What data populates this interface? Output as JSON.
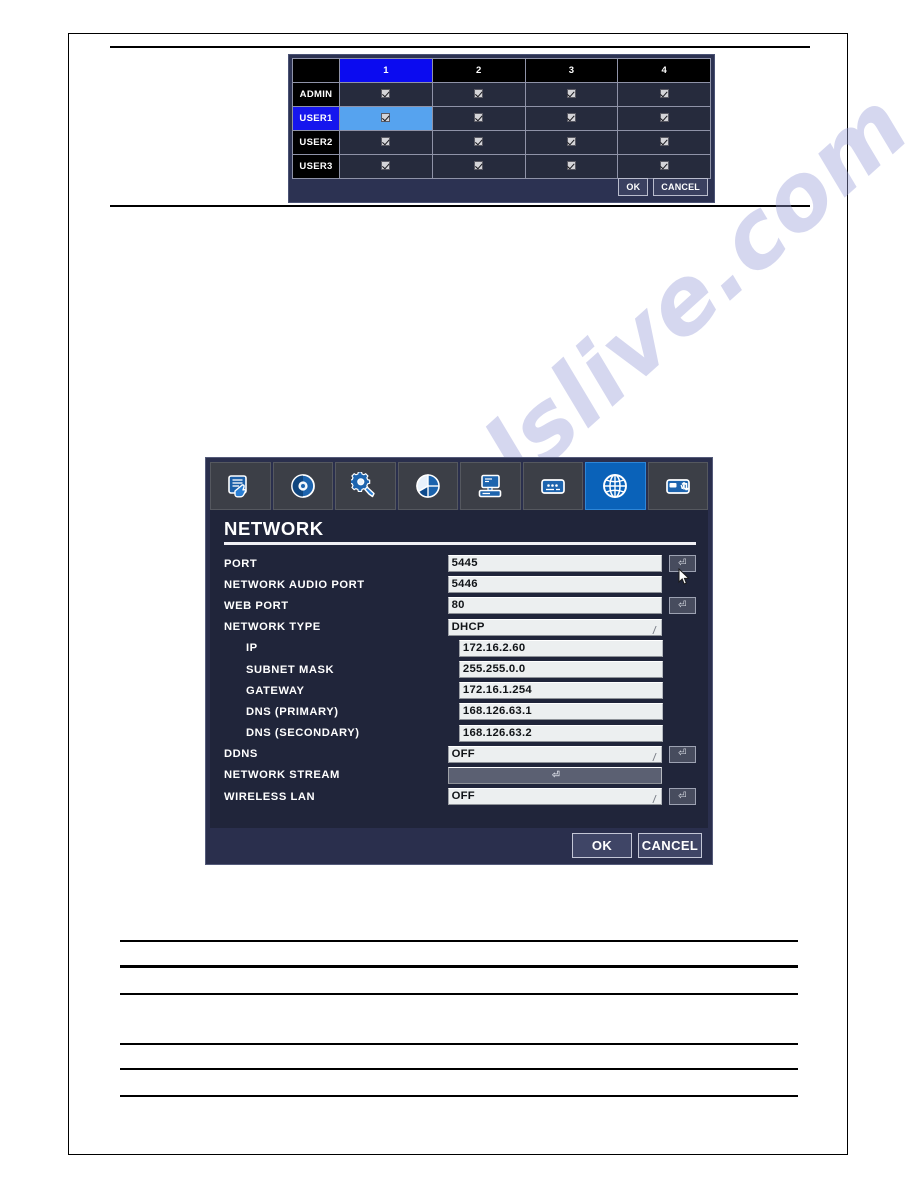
{
  "watermark": {
    "text": "manualslive.com"
  },
  "permission_dialog": {
    "name": "user-channel-permission",
    "columns": [
      "",
      "1",
      "2",
      "3",
      "4"
    ],
    "selected_column": "1",
    "selected_row": "USER1",
    "rows": [
      {
        "label": "ADMIN",
        "checks": [
          true,
          true,
          true,
          true
        ]
      },
      {
        "label": "USER1",
        "checks": [
          true,
          true,
          true,
          true
        ]
      },
      {
        "label": "USER2",
        "checks": [
          true,
          true,
          true,
          true
        ]
      },
      {
        "label": "USER3",
        "checks": [
          true,
          true,
          true,
          true
        ]
      }
    ],
    "buttons": {
      "ok": "OK",
      "cancel": "CANCEL"
    },
    "colors": {
      "header_selected": "#0b0bf0",
      "row_selected": "#1616ee",
      "cell_selected": "#56a3ef"
    }
  },
  "network_dialog": {
    "title": "NETWORK",
    "tabs": [
      {
        "name": "system-icon",
        "label": "SYSTEM",
        "active": false
      },
      {
        "name": "record-icon",
        "label": "RECORD",
        "active": false
      },
      {
        "name": "device-icon",
        "label": "DEVICE",
        "active": false
      },
      {
        "name": "display-icon",
        "label": "DISPLAY",
        "active": false
      },
      {
        "name": "storage-icon",
        "label": "STORAGE",
        "active": false
      },
      {
        "name": "event-icon",
        "label": "EVENT",
        "active": false
      },
      {
        "name": "network-icon",
        "label": "NETWORK",
        "active": true
      },
      {
        "name": "backup-icon",
        "label": "BACKUP",
        "active": false
      }
    ],
    "active_tab": "NETWORK",
    "fields": [
      {
        "label": "PORT",
        "value": "5445",
        "indent": false,
        "type": "text",
        "enter_button": true
      },
      {
        "label": "NETWORK  AUDIO  PORT",
        "value": "5446",
        "indent": false,
        "type": "text",
        "enter_button": false
      },
      {
        "label": "WEB  PORT",
        "value": "80",
        "indent": false,
        "type": "text",
        "enter_button": true
      },
      {
        "label": "NETWORK  TYPE",
        "value": "DHCP",
        "indent": false,
        "type": "select",
        "enter_button": false
      },
      {
        "label": "IP",
        "value": "172.16.2.60",
        "indent": true,
        "type": "text",
        "enter_button": false
      },
      {
        "label": "SUBNET  MASK",
        "value": "255.255.0.0",
        "indent": true,
        "type": "text",
        "enter_button": false
      },
      {
        "label": "GATEWAY",
        "value": "172.16.1.254",
        "indent": true,
        "type": "text",
        "enter_button": false
      },
      {
        "label": "DNS  (PRIMARY)",
        "value": "168.126.63.1",
        "indent": true,
        "type": "text",
        "enter_button": false
      },
      {
        "label": "DNS  (SECONDARY)",
        "value": "168.126.63.2",
        "indent": true,
        "type": "text",
        "enter_button": false
      },
      {
        "label": "DDNS",
        "value": "OFF",
        "indent": false,
        "type": "select",
        "enter_button": true
      },
      {
        "label": "NETWORK  STREAM",
        "value": "",
        "indent": false,
        "type": "submenu",
        "enter_button": false
      },
      {
        "label": "WIRELESS  LAN",
        "value": "OFF",
        "indent": false,
        "type": "select",
        "enter_button": true
      }
    ],
    "buttons": {
      "ok": "OK",
      "cancel": "CANCEL"
    },
    "colors": {
      "active_tab": "#0a62b9",
      "dialog_bg": "#20253a",
      "field_bg": "#eceff0"
    }
  }
}
